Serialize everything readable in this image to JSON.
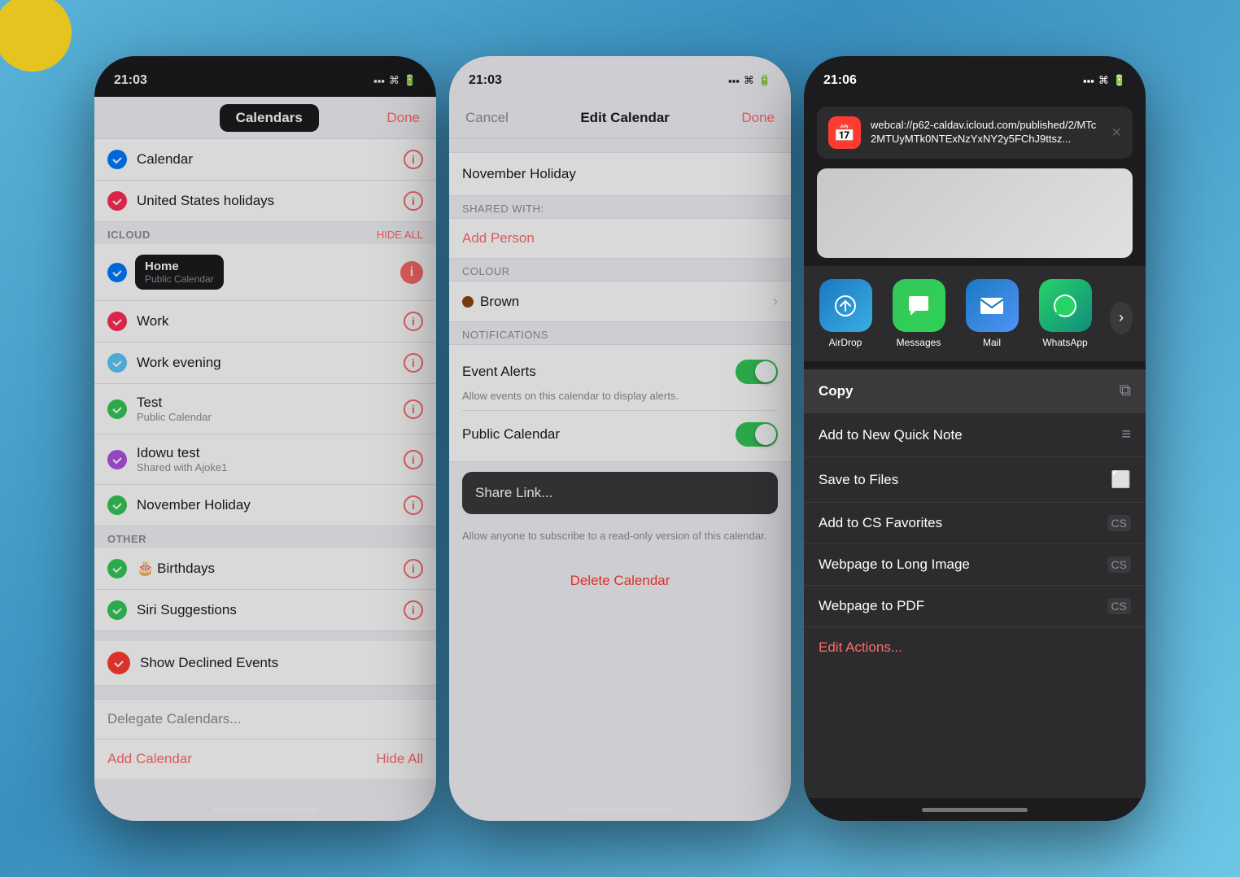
{
  "phone1": {
    "status_time": "21:03",
    "nav_title": "Calendars",
    "nav_done": "Done",
    "cal_item": "Calendar",
    "cal_us_holidays": "United States holidays",
    "icloud_section": "ICLOUD",
    "hide_all": "HIDE ALL",
    "home_label": "Home",
    "home_sub": "Public Calendar",
    "work_label": "Work",
    "work_evening_label": "Work evening",
    "test_label": "Test",
    "test_sub": "Public Calendar",
    "idowu_label": "Idowu test",
    "idowu_sub": "Shared with Ajoke1",
    "november_label": "November Holiday",
    "other_section": "OTHER",
    "birthdays_label": "Birthdays",
    "siri_label": "Siri Suggestions",
    "declined_label": "Show Declined Events",
    "delegate_label": "Delegate Calendars...",
    "add_calendar": "Add Calendar",
    "hide_all_btn": "Hide All"
  },
  "phone2": {
    "status_time": "21:03",
    "nav_cancel": "Cancel",
    "nav_title": "Edit Calendar",
    "nav_done": "Done",
    "calendar_name": "November Holiday",
    "shared_with_label": "SHARED WITH:",
    "add_person": "Add Person",
    "colour_label": "COLOUR",
    "colour_value": "Brown",
    "notifications_label": "NOTIFICATIONS",
    "event_alerts_label": "Event Alerts",
    "event_alerts_sub": "Allow events on this calendar to display alerts.",
    "public_cal_label": "Public Calendar",
    "share_link_label": "Share Link...",
    "share_link_sub": "Allow anyone to subscribe to a read-only version of this calendar.",
    "delete_cal": "Delete Calendar"
  },
  "phone3": {
    "status_time": "21:06",
    "url_text": "webcal://p62-caldav.icloud.com/published/2/MTc2MTUyMTk0NTExNzYxNY2y5FChJ9ttsz...",
    "airdrop_label": "AirDrop",
    "messages_label": "Messages",
    "mail_label": "Mail",
    "whatsapp_label": "WhatsApp",
    "copy_label": "Copy",
    "quick_note_label": "Add to New Quick Note",
    "save_files_label": "Save to Files",
    "cs_fav_label": "Add to CS Favorites",
    "long_image_label": "Webpage to Long Image",
    "pdf_label": "Webpage to PDF",
    "edit_actions_label": "Edit Actions..."
  },
  "icons": {
    "check": "✓",
    "info": "i",
    "chevron": "›",
    "close": "×",
    "copy_icon": "⧉",
    "note_icon": "≡",
    "folder_icon": "⬜",
    "cs_icon": "cs",
    "arrow_right": "›"
  }
}
